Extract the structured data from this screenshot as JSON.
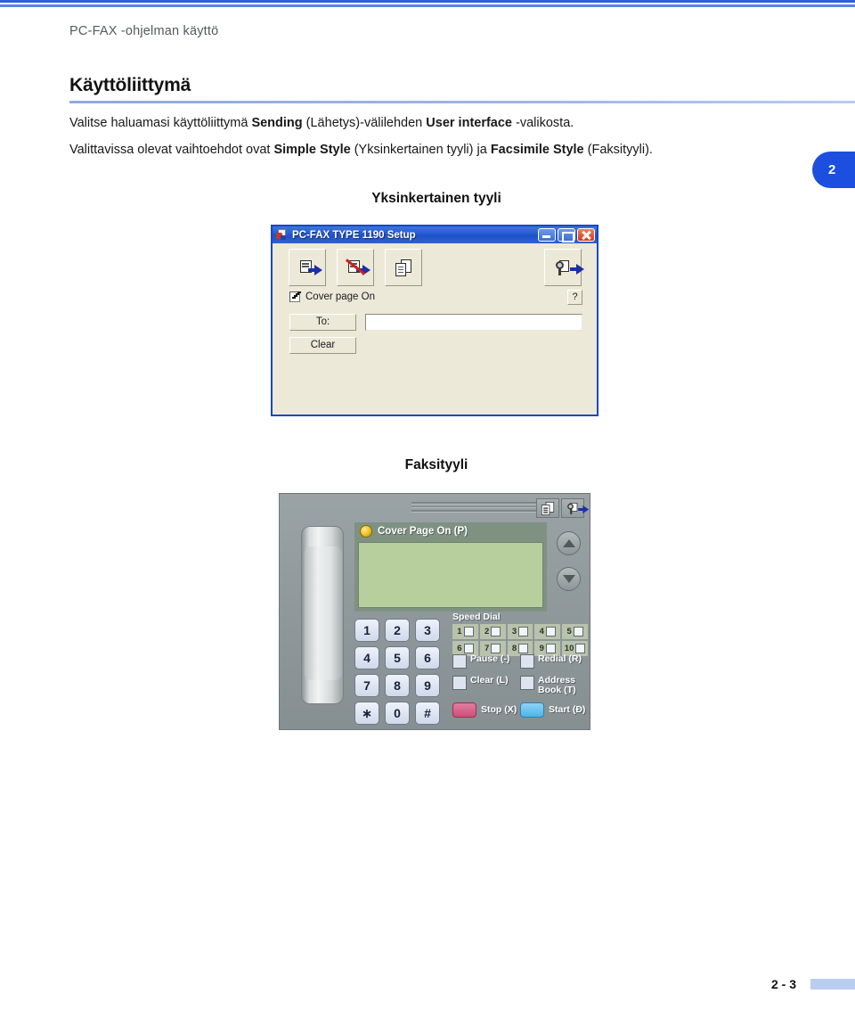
{
  "header": {
    "running_header": "PC-FAX -ohjelman käyttö",
    "section_heading": "Käyttöliittymä"
  },
  "chapter_tab": {
    "number": "2"
  },
  "body": {
    "para1": {
      "t1": "Valitse haluamasi käyttöliittymä ",
      "b1": "Sending",
      "t2": " (Lähetys)-välilehden ",
      "b2": "User interface",
      "t3": " -valikosta."
    },
    "para2": {
      "t1": "Valittavissa olevat vaihtoehdot ovat ",
      "b1": "Simple Style",
      "t2": " (Yksinkertainen tyyli) ja ",
      "b2": "Facsimile Style",
      "t3": " (Faksityyli)."
    }
  },
  "captions": {
    "simple": "Yksinkertainen tyyli",
    "facsimile": "Faksityyli"
  },
  "simple_dialog": {
    "title": "PC-FAX TYPE 1190 Setup",
    "window_buttons": {
      "minimize": "minimize-button",
      "maximize": "maximize-button",
      "close": "close-button"
    },
    "toolbar": [
      {
        "name": "send-fax-icon"
      },
      {
        "name": "send-fax-without-cover-icon"
      },
      {
        "name": "address-book-icon"
      },
      {
        "name": "setup-icon"
      }
    ],
    "cover_page_checkbox": {
      "label": "Cover page On",
      "checked": true
    },
    "help_button": "?",
    "to_button": "To:",
    "clear_button": "Clear",
    "to_input_value": ""
  },
  "fax_panel": {
    "cover_page_label": "Cover Page On (P)",
    "lcd_value": "",
    "icons": {
      "address_book": "address-book-icon",
      "setup": "setup-icon",
      "scroll_up": "scroll-up-icon",
      "scroll_down": "scroll-down-icon"
    },
    "keypad": [
      [
        "1",
        "2",
        "3"
      ],
      [
        "4",
        "5",
        "6"
      ],
      [
        "7",
        "8",
        "9"
      ],
      [
        "∗",
        "0",
        "#"
      ]
    ],
    "speed_dial": {
      "title": "Speed Dial",
      "row1": [
        "1",
        "2",
        "3",
        "4",
        "5"
      ],
      "row2": [
        "6",
        "7",
        "8",
        "9",
        "10"
      ]
    },
    "function_buttons": [
      "Pause (-)",
      "Redial (R)",
      "Clear (L)",
      "Address Book (T)"
    ],
    "action_buttons": [
      {
        "label": "Stop (X)",
        "color": "#cf4d77"
      },
      {
        "label": "Start (Ð)",
        "color": "#4cb5ea"
      }
    ]
  },
  "footer": {
    "page_number": "2 - 3"
  },
  "colors": {
    "rule_blue": "#2c5fd8",
    "tab_blue": "#1c4fe0",
    "heading_rule": "#8fa9e0",
    "footer_bar": "#b8cdf0",
    "dialog_border": "#1847c8",
    "dialog_face": "#ece9d8"
  }
}
